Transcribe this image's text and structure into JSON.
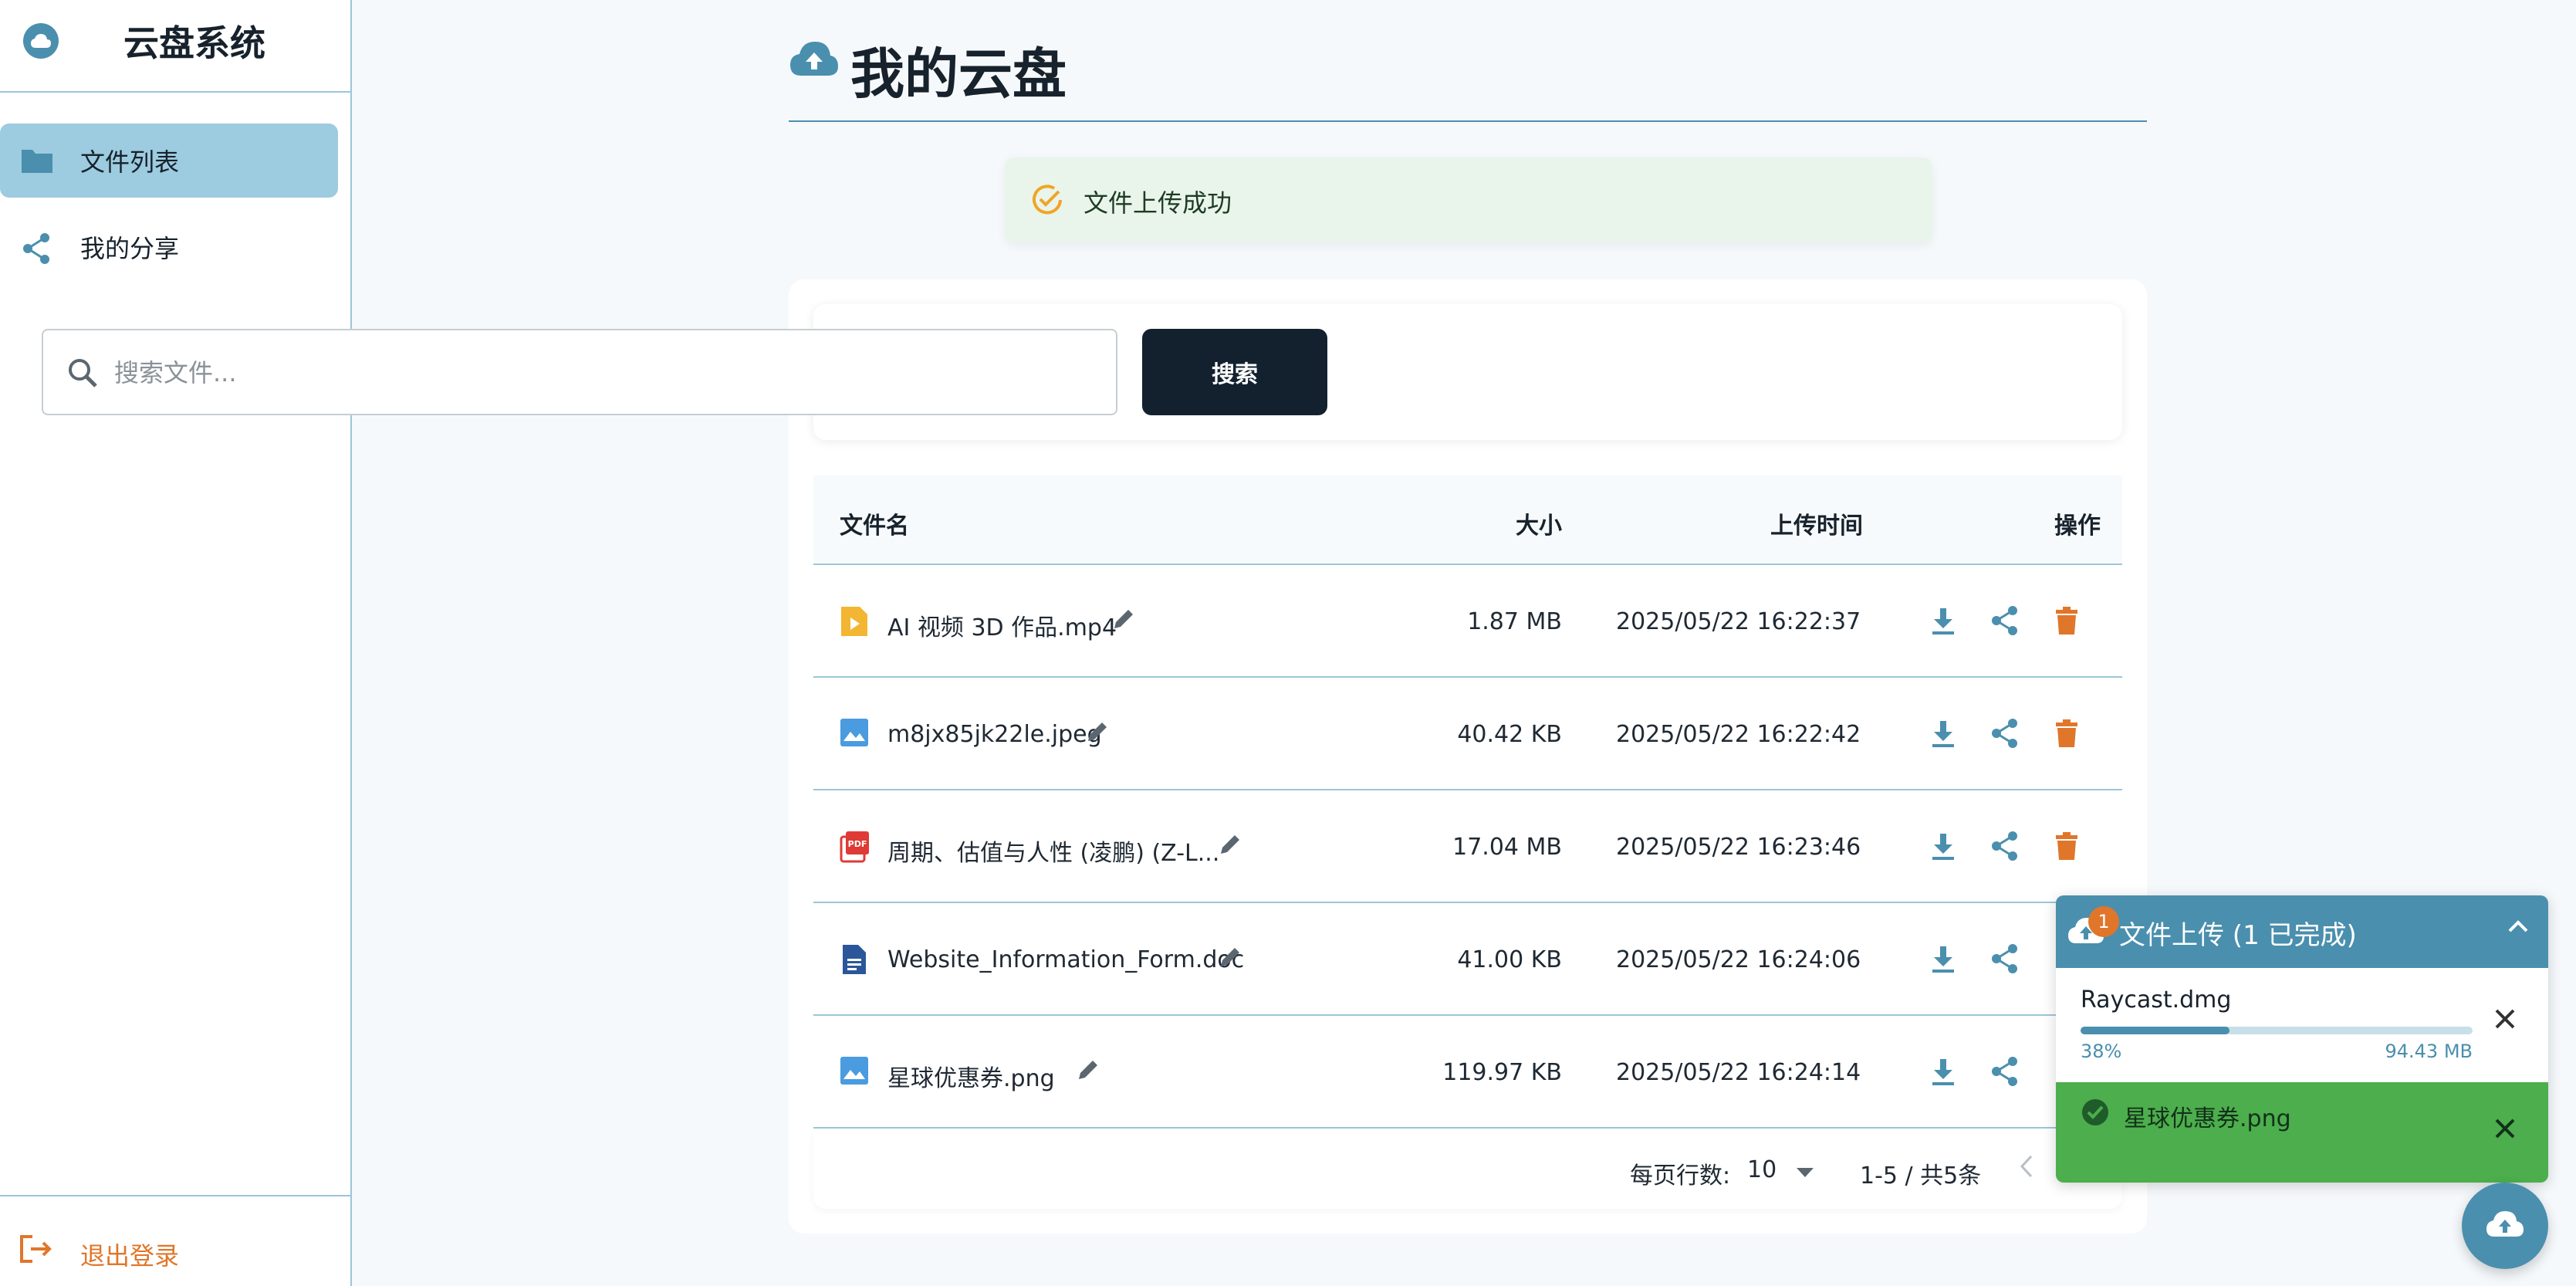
{
  "sidebar": {
    "title": "云盘系统",
    "items": [
      {
        "label": "文件列表",
        "icon": "folder-icon",
        "active": true
      },
      {
        "label": "我的分享",
        "icon": "share-icon",
        "active": false
      }
    ],
    "logout_label": "退出登录"
  },
  "header": {
    "title": "我的云盘",
    "icon": "cloud-upload-icon"
  },
  "alert": {
    "message": "文件上传成功",
    "icon": "check-circle-icon"
  },
  "search": {
    "placeholder": "搜索文件...",
    "button_label": "搜索"
  },
  "table": {
    "columns": [
      "文件名",
      "大小",
      "上传时间",
      "操作"
    ],
    "rows": [
      {
        "name": "AI 视频 3D 作品.mp4",
        "type": "video",
        "size": "1.87 MB",
        "time": "2025/05/22 16:22:37",
        "deletable": true
      },
      {
        "name": "m8jx85jk22le.jpeg",
        "type": "image",
        "size": "40.42 KB",
        "time": "2025/05/22 16:22:42",
        "deletable": true
      },
      {
        "name": "周期、估值与人性 (凌鹏) (Z-L...",
        "type": "pdf",
        "size": "17.04 MB",
        "time": "2025/05/22 16:23:46",
        "deletable": true
      },
      {
        "name": "Website_Information_Form.doc",
        "type": "doc",
        "size": "41.00 KB",
        "time": "2025/05/22 16:24:06",
        "deletable": false
      },
      {
        "name": "星球优惠券.png",
        "type": "image",
        "size": "119.97 KB",
        "time": "2025/05/22 16:24:14",
        "deletable": false
      }
    ]
  },
  "pagination": {
    "rows_per_page_label": "每页行数:",
    "rows_per_page": "10",
    "range": "1-5 / 共5条"
  },
  "upload_panel": {
    "title": "文件上传 (1 已完成)",
    "badge": "1",
    "items": [
      {
        "name": "Raycast.dmg",
        "progress_label": "38%",
        "progress": 0.38,
        "size": "94.43 MB",
        "status": "uploading"
      },
      {
        "name": "星球优惠券.png",
        "status": "done"
      }
    ]
  },
  "colors": {
    "accent": "#4a8fae",
    "danger": "#e0762a",
    "success": "#4cae4c",
    "dark": "#13212f"
  }
}
